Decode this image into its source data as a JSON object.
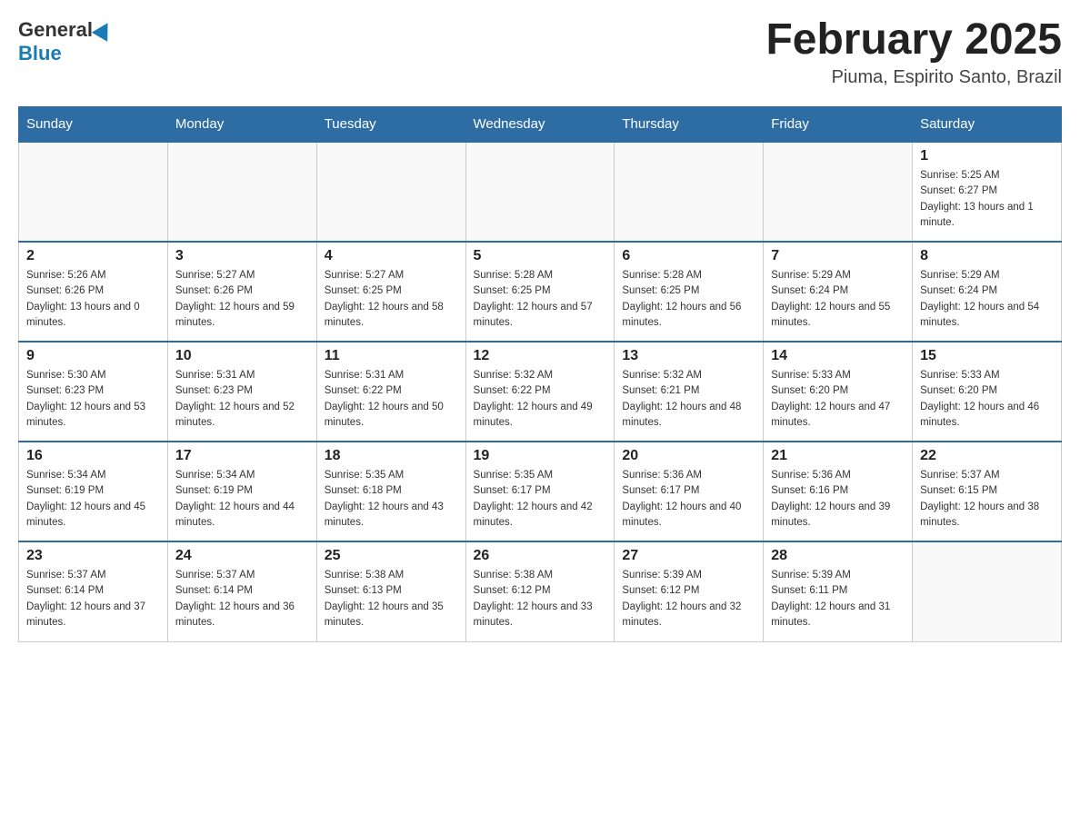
{
  "header": {
    "logo_general": "General",
    "logo_blue": "Blue",
    "month_title": "February 2025",
    "location": "Piuma, Espirito Santo, Brazil"
  },
  "days_of_week": [
    "Sunday",
    "Monday",
    "Tuesday",
    "Wednesday",
    "Thursday",
    "Friday",
    "Saturday"
  ],
  "weeks": [
    [
      {
        "day": "",
        "info": ""
      },
      {
        "day": "",
        "info": ""
      },
      {
        "day": "",
        "info": ""
      },
      {
        "day": "",
        "info": ""
      },
      {
        "day": "",
        "info": ""
      },
      {
        "day": "",
        "info": ""
      },
      {
        "day": "1",
        "info": "Sunrise: 5:25 AM\nSunset: 6:27 PM\nDaylight: 13 hours and 1 minute."
      }
    ],
    [
      {
        "day": "2",
        "info": "Sunrise: 5:26 AM\nSunset: 6:26 PM\nDaylight: 13 hours and 0 minutes."
      },
      {
        "day": "3",
        "info": "Sunrise: 5:27 AM\nSunset: 6:26 PM\nDaylight: 12 hours and 59 minutes."
      },
      {
        "day": "4",
        "info": "Sunrise: 5:27 AM\nSunset: 6:25 PM\nDaylight: 12 hours and 58 minutes."
      },
      {
        "day": "5",
        "info": "Sunrise: 5:28 AM\nSunset: 6:25 PM\nDaylight: 12 hours and 57 minutes."
      },
      {
        "day": "6",
        "info": "Sunrise: 5:28 AM\nSunset: 6:25 PM\nDaylight: 12 hours and 56 minutes."
      },
      {
        "day": "7",
        "info": "Sunrise: 5:29 AM\nSunset: 6:24 PM\nDaylight: 12 hours and 55 minutes."
      },
      {
        "day": "8",
        "info": "Sunrise: 5:29 AM\nSunset: 6:24 PM\nDaylight: 12 hours and 54 minutes."
      }
    ],
    [
      {
        "day": "9",
        "info": "Sunrise: 5:30 AM\nSunset: 6:23 PM\nDaylight: 12 hours and 53 minutes."
      },
      {
        "day": "10",
        "info": "Sunrise: 5:31 AM\nSunset: 6:23 PM\nDaylight: 12 hours and 52 minutes."
      },
      {
        "day": "11",
        "info": "Sunrise: 5:31 AM\nSunset: 6:22 PM\nDaylight: 12 hours and 50 minutes."
      },
      {
        "day": "12",
        "info": "Sunrise: 5:32 AM\nSunset: 6:22 PM\nDaylight: 12 hours and 49 minutes."
      },
      {
        "day": "13",
        "info": "Sunrise: 5:32 AM\nSunset: 6:21 PM\nDaylight: 12 hours and 48 minutes."
      },
      {
        "day": "14",
        "info": "Sunrise: 5:33 AM\nSunset: 6:20 PM\nDaylight: 12 hours and 47 minutes."
      },
      {
        "day": "15",
        "info": "Sunrise: 5:33 AM\nSunset: 6:20 PM\nDaylight: 12 hours and 46 minutes."
      }
    ],
    [
      {
        "day": "16",
        "info": "Sunrise: 5:34 AM\nSunset: 6:19 PM\nDaylight: 12 hours and 45 minutes."
      },
      {
        "day": "17",
        "info": "Sunrise: 5:34 AM\nSunset: 6:19 PM\nDaylight: 12 hours and 44 minutes."
      },
      {
        "day": "18",
        "info": "Sunrise: 5:35 AM\nSunset: 6:18 PM\nDaylight: 12 hours and 43 minutes."
      },
      {
        "day": "19",
        "info": "Sunrise: 5:35 AM\nSunset: 6:17 PM\nDaylight: 12 hours and 42 minutes."
      },
      {
        "day": "20",
        "info": "Sunrise: 5:36 AM\nSunset: 6:17 PM\nDaylight: 12 hours and 40 minutes."
      },
      {
        "day": "21",
        "info": "Sunrise: 5:36 AM\nSunset: 6:16 PM\nDaylight: 12 hours and 39 minutes."
      },
      {
        "day": "22",
        "info": "Sunrise: 5:37 AM\nSunset: 6:15 PM\nDaylight: 12 hours and 38 minutes."
      }
    ],
    [
      {
        "day": "23",
        "info": "Sunrise: 5:37 AM\nSunset: 6:14 PM\nDaylight: 12 hours and 37 minutes."
      },
      {
        "day": "24",
        "info": "Sunrise: 5:37 AM\nSunset: 6:14 PM\nDaylight: 12 hours and 36 minutes."
      },
      {
        "day": "25",
        "info": "Sunrise: 5:38 AM\nSunset: 6:13 PM\nDaylight: 12 hours and 35 minutes."
      },
      {
        "day": "26",
        "info": "Sunrise: 5:38 AM\nSunset: 6:12 PM\nDaylight: 12 hours and 33 minutes."
      },
      {
        "day": "27",
        "info": "Sunrise: 5:39 AM\nSunset: 6:12 PM\nDaylight: 12 hours and 32 minutes."
      },
      {
        "day": "28",
        "info": "Sunrise: 5:39 AM\nSunset: 6:11 PM\nDaylight: 12 hours and 31 minutes."
      },
      {
        "day": "",
        "info": ""
      }
    ]
  ]
}
